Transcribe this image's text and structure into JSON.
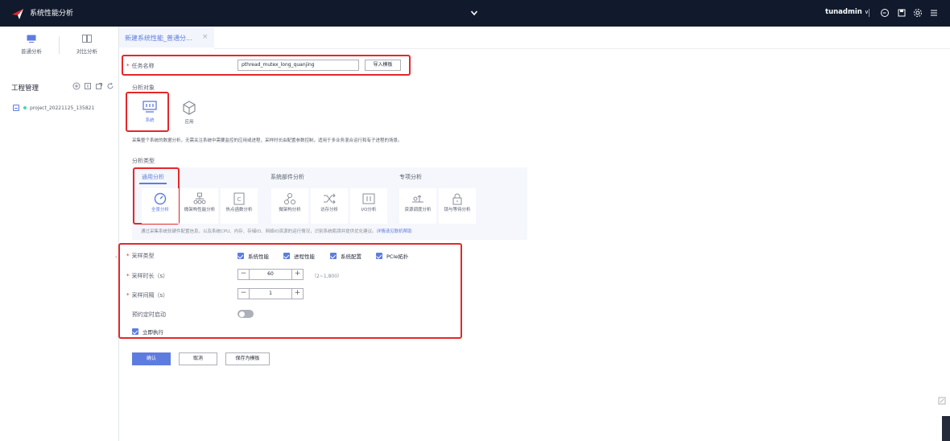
{
  "app": {
    "title": "系统性能分析",
    "user": "tunadmin"
  },
  "topbar_icons": [
    "chevron-down-icon",
    "logout-icon",
    "save-icon",
    "settings-icon",
    "menu-icon"
  ],
  "sidebar": {
    "tabs": [
      {
        "label": "普通分析",
        "icon": "monitor-icon",
        "active": true
      },
      {
        "label": "对比分析",
        "icon": "compare-icon",
        "active": false
      }
    ],
    "project_title": "工程管理",
    "project_actions": [
      "add-icon",
      "import-icon",
      "export-icon",
      "refresh-icon"
    ],
    "project_item": "project_20221125_135821"
  },
  "tab": {
    "label": "新建系统性能_普通分...",
    "close": "×"
  },
  "form": {
    "task_name_label": "任务名称",
    "task_name_value": "pthread_mutex_long_quanjing",
    "import_template_label": "导入模板",
    "analysis_object_title": "分析对象",
    "objects": [
      {
        "label": "系统",
        "icon": "monitor-icon",
        "selected": true
      },
      {
        "label": "应用",
        "icon": "cube-icon",
        "selected": false
      }
    ],
    "object_desc": "采集整个系统的数据分析，无需关注系统中需要监控的应用或进程，采样时长由配置参数控制，适用于多业务混合运行和有子进程的场景。",
    "analysis_type_title": "分析类型",
    "type_tabs": [
      "通用分析",
      "系统部件分析",
      "专项分析"
    ],
    "type_cards": [
      {
        "label": "全景分析",
        "icon": "gauge-icon",
        "selected": true
      },
      {
        "label": "微架构性能分析",
        "icon": "topology-icon",
        "selected": false
      },
      {
        "label": "热点函数分析",
        "icon": "code-icon",
        "selected": false
      },
      {
        "label": "微架构分析",
        "icon": "node-icon",
        "selected": false
      },
      {
        "label": "访存分析",
        "icon": "shuffle-icon",
        "selected": false
      },
      {
        "label": "I/O分析",
        "icon": "io-icon",
        "selected": false
      },
      {
        "label": "资源调度分析",
        "icon": "schedule-icon",
        "selected": false
      },
      {
        "label": "锁与等待分析",
        "icon": "lock-icon",
        "selected": false
      }
    ],
    "type_desc": "通过采集系统软硬件配置信息，以及系统CPU、内存、存储IO、网络IO资源的运行情况，识别系统瓶颈并提供优化建议。",
    "type_desc_link": "详情请见联机帮助",
    "sample_type_label": "采样类型",
    "sample_types": [
      "系统性能",
      "进程性能",
      "系统配置",
      "PCIe拓扑"
    ],
    "duration_label": "采样时长（s）",
    "duration_value": "60",
    "duration_range": "（2~1,800）",
    "interval_label": "采样间隔（s）",
    "interval_value": "1",
    "scheduled_label": "预约定时启动",
    "scheduled_on": false,
    "immediate_label": "立即执行",
    "immediate_checked": true,
    "minus": "−",
    "plus": "+",
    "buttons": {
      "confirm": "确认",
      "cancel": "取消",
      "save_template": "保存为模板"
    }
  },
  "colors": {
    "topbar": "#101a2c",
    "accent": "#5e7ce0",
    "highlight": "#e5272a"
  }
}
